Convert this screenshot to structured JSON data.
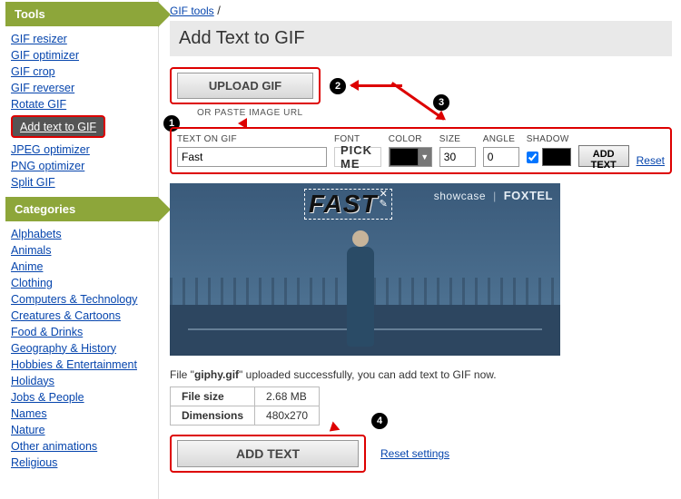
{
  "sidebar": {
    "tools_header": "Tools",
    "tools": [
      "GIF resizer",
      "GIF optimizer",
      "GIF crop",
      "GIF reverser",
      "Rotate GIF",
      "Add text to GIF",
      "JPEG optimizer",
      "PNG optimizer",
      "Split GIF"
    ],
    "active_index": 5,
    "categories_header": "Categories",
    "categories": [
      "Alphabets",
      "Animals",
      "Anime",
      "Clothing",
      "Computers & Technology",
      "Creatures & Cartoons",
      "Food & Drinks",
      "Geography & History",
      "Hobbies & Entertainment",
      "Holidays",
      "Jobs & People",
      "Names",
      "Nature",
      "Other animations",
      "Religious"
    ]
  },
  "breadcrumb": {
    "text": "GIF tools",
    "sep": " /"
  },
  "page_title": "Add Text to GIF",
  "upload": {
    "button": "UPLOAD GIF",
    "or_paste": "OR PASTE IMAGE URL"
  },
  "controls": {
    "text_label": "TEXT ON GIF",
    "text_value": "Fast",
    "font_label": "FONT",
    "font_sample": "PICK ME",
    "color_label": "COLOR",
    "size_label": "SIZE",
    "size_value": "30",
    "angle_label": "ANGLE",
    "angle_value": "0",
    "shadow_label": "SHADOW",
    "shadow_checked": true,
    "add_text_btn": "ADD TEXT",
    "reset": "Reset"
  },
  "preview": {
    "overlay_text": "FAST",
    "watermark_left": "showcase",
    "watermark_right": "FOXTEL"
  },
  "status": {
    "prefix": "File \"",
    "filename": "giphy.gif",
    "suffix": "\" uploaded successfully, you can add text to GIF now."
  },
  "info_table": {
    "rows": [
      {
        "k": "File size",
        "v": "2.68 MB"
      },
      {
        "k": "Dimensions",
        "v": "480x270"
      }
    ]
  },
  "bottom": {
    "add_text_btn": "ADD TEXT",
    "reset_settings": "Reset settings"
  },
  "annotations": {
    "n1": "1",
    "n2": "2",
    "n3": "3",
    "n4": "4"
  }
}
